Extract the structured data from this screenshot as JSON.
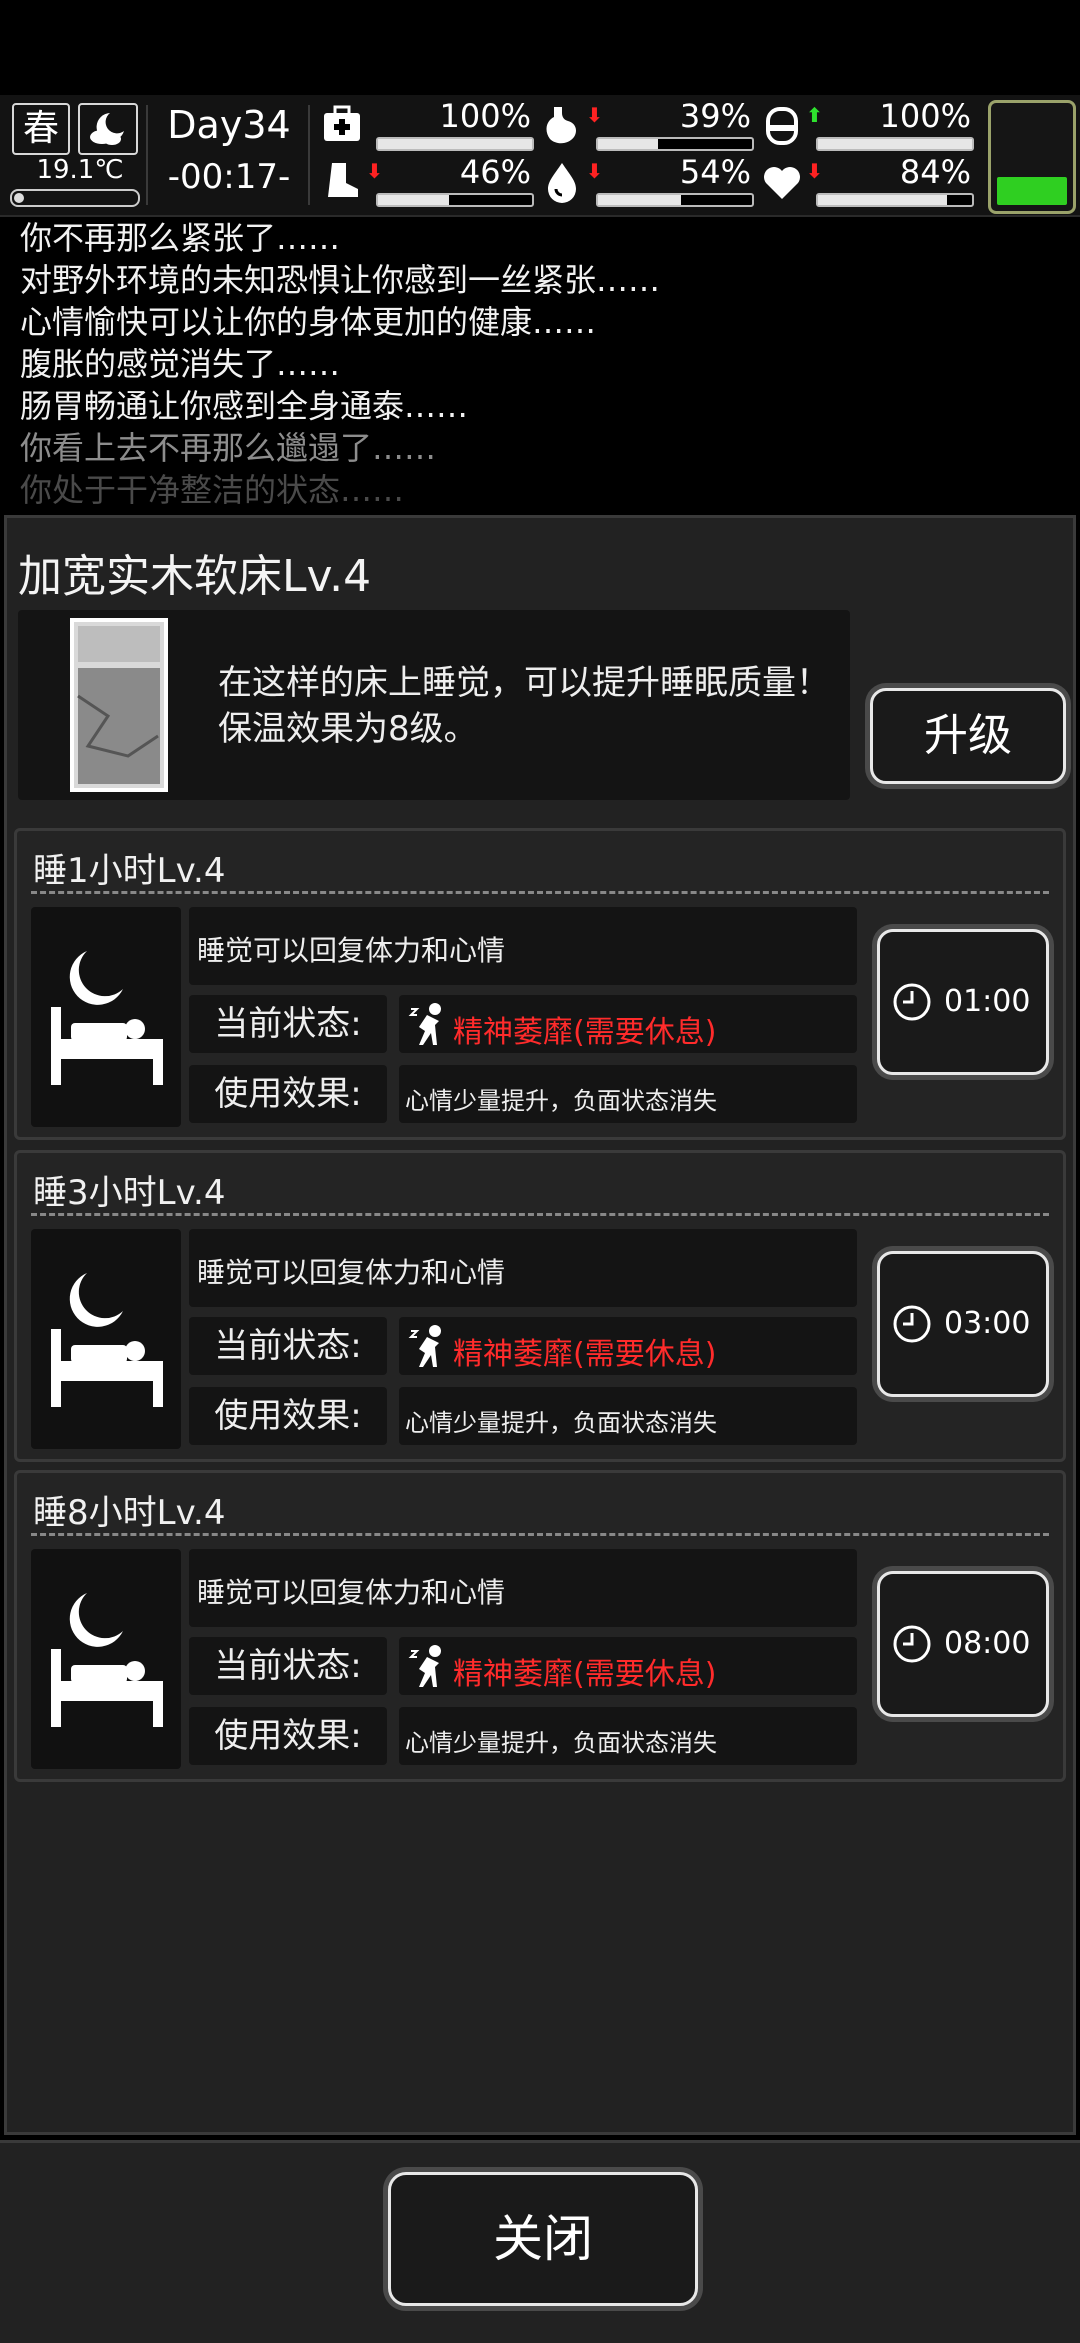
{
  "hud": {
    "season": "春",
    "weather_icon": "partly-cloudy-night-icon",
    "temperature": "19.1℃",
    "day": "Day34",
    "time": "-00:17-",
    "stats": [
      {
        "name": "health",
        "icon": "medkit-icon",
        "value": "100%",
        "level": 1.0,
        "trend": ""
      },
      {
        "name": "hunger",
        "icon": "stomach-icon",
        "value": "39%",
        "level": 0.39,
        "trend": "down"
      },
      {
        "name": "bladder",
        "icon": "pill-icon",
        "value": "100%",
        "level": 1.0,
        "trend": "up"
      },
      {
        "name": "stamina",
        "icon": "boot-icon",
        "value": "46%",
        "level": 0.46,
        "trend": "down"
      },
      {
        "name": "thirst",
        "icon": "water-drop-icon",
        "value": "54%",
        "level": 0.54,
        "trend": "down"
      },
      {
        "name": "mood",
        "icon": "heart-icon",
        "value": "84%",
        "level": 0.84,
        "trend": "down"
      }
    ],
    "battery_icon": "battery-icon",
    "colors": {
      "up": "#2ee22e",
      "down": "#ff2222",
      "battery": "#2fcf21"
    }
  },
  "log": [
    "你不再那么紧张了……",
    "对野外环境的未知恐惧让你感到一丝紧张……",
    "心情愉快可以让你的身体更加的健康……",
    "腹胀的感觉消失了……",
    "肠胃畅通让你感到全身通泰……",
    "你看上去不再那么邋遢了……",
    "你处于干净整洁的状态……"
  ],
  "bed": {
    "title": "加宽实木软床Lv.4",
    "description": "在这样的床上睡觉，可以提升睡眠质量！保温效果为8级。",
    "upgrade_label": "升级"
  },
  "sleep_options": [
    {
      "title": "睡1小时Lv.4",
      "description": "睡觉可以回复体力和心情",
      "status_label": "当前状态:",
      "status": "精神萎靡(需要休息)",
      "effect_label": "使用效果:",
      "effect": "心情少量提升，负面状态消失",
      "time": "01:00"
    },
    {
      "title": "睡3小时Lv.4",
      "description": "睡觉可以回复体力和心情",
      "status_label": "当前状态:",
      "status": "精神萎靡(需要休息)",
      "effect_label": "使用效果:",
      "effect": "心情少量提升，负面状态消失",
      "time": "03:00"
    },
    {
      "title": "睡8小时Lv.4",
      "description": "睡觉可以回复体力和心情",
      "status_label": "当前状态:",
      "status": "精神萎靡(需要休息)",
      "effect_label": "使用效果:",
      "effect": "心情少量提升，负面状态消失",
      "time": "08:00"
    }
  ],
  "close_label": "关闭"
}
